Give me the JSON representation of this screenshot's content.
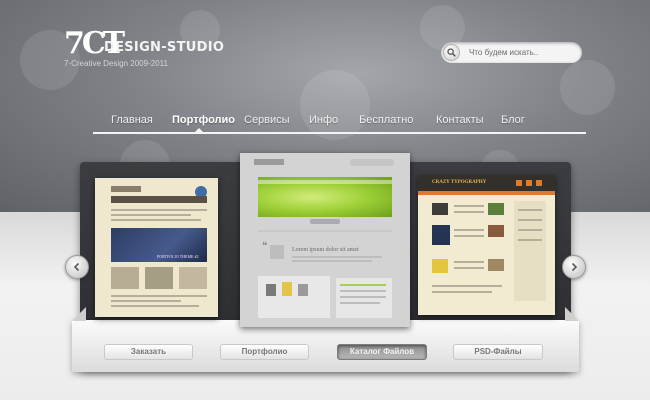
{
  "logo": {
    "mark": "7CT",
    "name": "DESIGN-STUDIO",
    "tagline": "7-Creative Design 2009-2011"
  },
  "search": {
    "placeholder": "Что будем искать..",
    "value": ""
  },
  "nav": {
    "items": [
      {
        "label": "Главная"
      },
      {
        "label": "Портфолио",
        "active": true
      },
      {
        "label": "Сервисы"
      },
      {
        "label": "Инфо"
      },
      {
        "label": "Бесплатно"
      },
      {
        "label": "Контакты"
      },
      {
        "label": "Блог"
      }
    ]
  },
  "showcase": {
    "center_card_heading": "Lorem ipsum dolor sit amet",
    "right_card_heading": "CRAZY TYPOGRAPHY",
    "left_card_heading": "PORTFOLIO THEME #2"
  },
  "buttons": [
    {
      "label": "Заказать"
    },
    {
      "label": "Портфолио"
    },
    {
      "label": "Каталог Файлов",
      "selected": true
    },
    {
      "label": "PSD-Файлы"
    }
  ],
  "colors": {
    "header_bg": "#7f8287",
    "accent_green": "#8fbf2b",
    "accent_orange": "#e07a26",
    "left_card_bg": "#efe8cf"
  }
}
